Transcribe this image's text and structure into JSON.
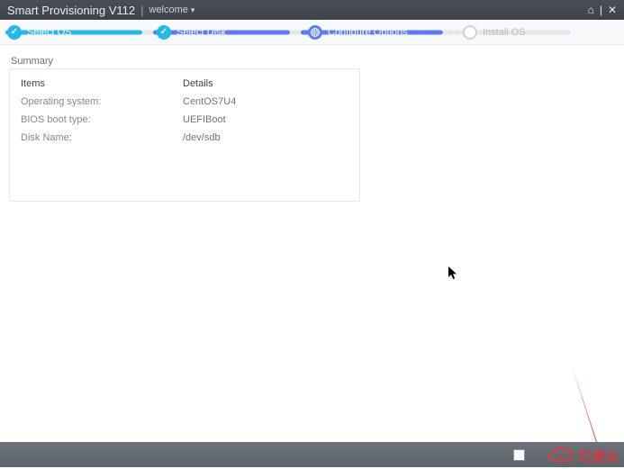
{
  "header": {
    "title": "Smart Provisioning V112",
    "menu_label": "welcome",
    "home_icon": "home-icon",
    "sep": "|",
    "close_icon": "close-icon"
  },
  "steps": {
    "s1": "Select OS",
    "s2": "Select Disk",
    "s3": "Configure Options",
    "s4": "Install OS"
  },
  "summary": {
    "title": "Summary",
    "head_items": "Items",
    "head_details": "Details",
    "rows": [
      {
        "k": "Operating system:",
        "v": "CentOS7U4"
      },
      {
        "k": "BIOS boot type:",
        "v": "UEFIBoot"
      },
      {
        "k": "Disk Name:",
        "v": "/dev/sdb"
      }
    ]
  },
  "watermark": {
    "text": "亿速云"
  }
}
